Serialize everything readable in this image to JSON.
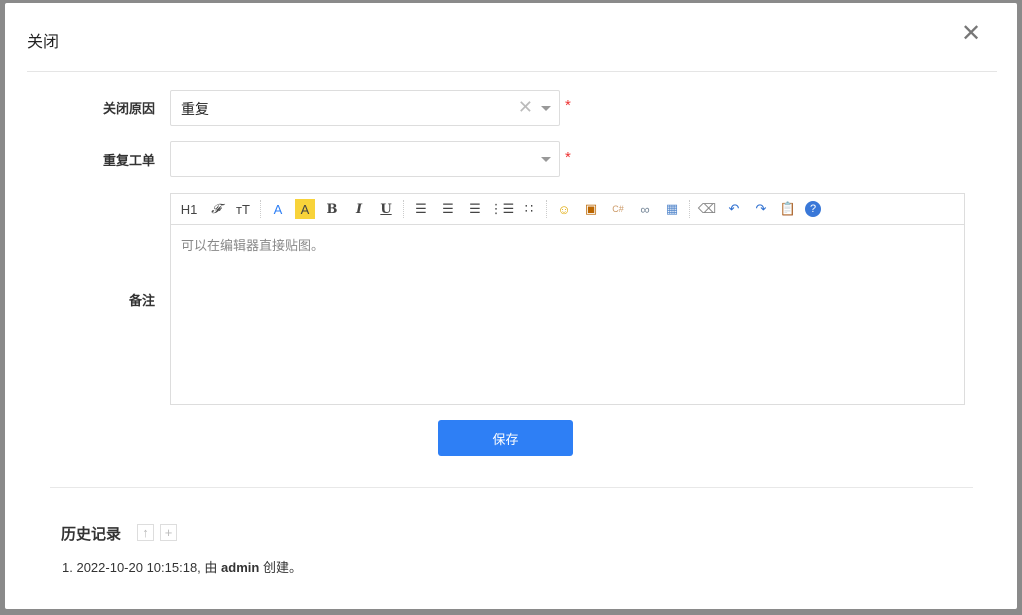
{
  "modal": {
    "title": "关闭"
  },
  "form": {
    "close_reason": {
      "label": "关闭原因",
      "value": "重复"
    },
    "duplicate": {
      "label": "重复工单",
      "value": ""
    },
    "remark": {
      "label": "备注",
      "placeholder": "可以在编辑器直接贴图。"
    },
    "required_mark": "*",
    "save_label": "保存"
  },
  "toolbar": {
    "h1": "H1",
    "font": "𝓕",
    "size": "тT",
    "color": "A",
    "bg": "A",
    "bold": "B",
    "italic": "I",
    "underline": "U"
  },
  "history": {
    "title": "历史记录",
    "items": [
      {
        "index": "1.",
        "text_before": "2022-10-20 10:15:18, 由 ",
        "user": "admin",
        "text_after": " 创建。"
      }
    ]
  }
}
